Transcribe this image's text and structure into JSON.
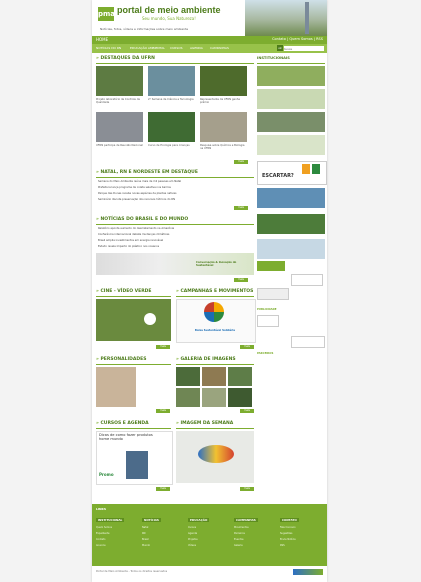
{
  "header": {
    "logo": "pma",
    "title": "portal de meio ambiente",
    "subtitle": "Seu mundo, Sua Natureza!",
    "tagline": "Notícias, fotos, vídeos e informações sobre meio ambiente"
  },
  "nav": {
    "home": "HOME",
    "right": "Contato | Quem Somos | RSS",
    "items": [
      "NOTÍCIAS DO RN",
      "EDUCAÇÃO AMBIENTAL",
      "CURSOS",
      "AGENDA",
      "CAMPANHAS"
    ],
    "search_placeholder": "busca",
    "search_go": "ok"
  },
  "destaques": {
    "title": "DESTAQUES DA UFRN",
    "items": [
      {
        "caption": "Projeto laboratório de Controle de Qualidade"
      },
      {
        "caption": "2ª Semana de Ciência e Tecnologia"
      },
      {
        "caption": "Representante da UFRN ganha prêmio"
      },
      {
        "caption": "UFRN participa de Reunião Nacional"
      },
      {
        "caption": "Curso de Ecologia para crianças"
      },
      {
        "caption": "Pesquisa sobre Química e Biologia na UFRN"
      }
    ],
    "more": "mais"
  },
  "natal": {
    "title": "NATAL, RN E NORDESTE EM DESTAQUE",
    "lines": [
      "Semana do Meio Ambiente reúne mais de mil pessoas em Natal",
      "Prefeitura lança programa de coleta seletiva nos bairros",
      "Parque das Dunas recebe novas espécies de plantas nativas",
      "Seminário discute preservação dos recursos hídricos do RN"
    ],
    "more": "mais"
  },
  "brasil": {
    "title": "NOTÍCIAS DO BRASIL E DO MUNDO",
    "lines": [
      "Relatório aponta aumento do desmatamento na Amazônia",
      "Conferência internacional debate mudanças climáticas",
      "Brasil amplia investimentos em energia renovável",
      "Estudo revela impacto do plástico nos oceanos"
    ],
    "banner_text": "Conversação & Inovação do Sustentável",
    "more": "mais"
  },
  "cine": {
    "title": "CINE - VÍDEO VERDE",
    "more": "mais"
  },
  "campanhas": {
    "title": "CAMPANHAS E MOVIMENTOS",
    "campaign_label": "Bolsa Sustentável Solidária",
    "more": "mais"
  },
  "personalidades": {
    "title": "PERSONALIDADES",
    "more": "mais"
  },
  "galeria": {
    "title": "GALERIA DE IMAGENS",
    "more": "mais"
  },
  "cursos": {
    "title": "CURSOS E AGENDA",
    "ad_title": "Dicas de como fazer produtos home mundo",
    "ad_price": "Promo",
    "more": "mais"
  },
  "imagem": {
    "title": "IMAGEM DA SEMANA",
    "more": "mais"
  },
  "right": {
    "title": "INSTITUCIONAIS",
    "escartar": "ESCARTAR?",
    "labels": [
      "PUBLICIDADE",
      "PARCEIROS"
    ],
    "more": "mais"
  },
  "footer": {
    "title": "LINKS",
    "columns": [
      {
        "title": "INSTITUCIONAL",
        "links": [
          "Quem Somos",
          "Expediente",
          "Contato",
          "Anuncie"
        ]
      },
      {
        "title": "NOTÍCIAS",
        "links": [
          "Natal",
          "RN",
          "Brasil",
          "Mundo"
        ]
      },
      {
        "title": "EDUCAÇÃO",
        "links": [
          "Cursos",
          "Agenda",
          "Projetos",
          "Vídeos"
        ]
      },
      {
        "title": "CAMPANHAS",
        "links": [
          "Movimentos",
          "Parceiros",
          "Eventos",
          "Galeria"
        ]
      },
      {
        "title": "CONTATO",
        "links": [
          "Fale Conosco",
          "Sugestões",
          "Envie Notícia",
          "RSS"
        ]
      }
    ],
    "copyright": "Portal de Meio Ambiente - Todos os direitos reservados"
  }
}
